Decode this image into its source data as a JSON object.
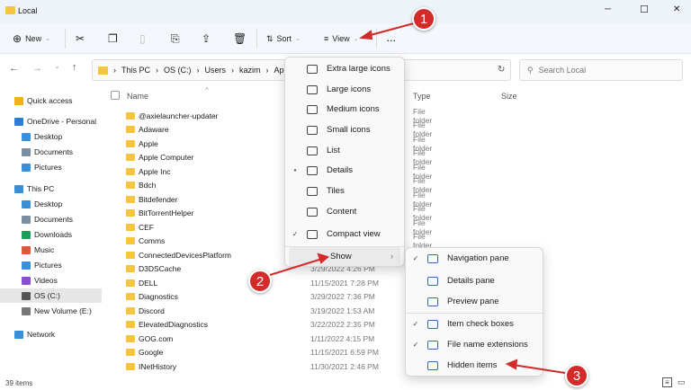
{
  "window": {
    "title": "Local",
    "minimize": "─",
    "maximize": "☐",
    "close": "✕"
  },
  "toolbar": {
    "new": "New",
    "sort": "Sort",
    "view": "View",
    "more": "..."
  },
  "address": {
    "segments": [
      "This PC",
      "OS (C:)",
      "Users",
      "kazim",
      "AppD"
    ],
    "search_placeholder": "Search Local"
  },
  "sidebar": {
    "items": [
      {
        "label": "Quick access",
        "color": "#f2b01e"
      },
      {
        "label": "OneDrive - Personal",
        "color": "#2d7dd2"
      },
      {
        "label": "Desktop",
        "color": "#3a8fd9"
      },
      {
        "label": "Documents",
        "color": "#7a8ea3"
      },
      {
        "label": "Pictures",
        "color": "#3a8fd9"
      },
      {
        "label": "This PC",
        "color": "#3a8fd9"
      },
      {
        "label": "Desktop",
        "color": "#3a8fd9"
      },
      {
        "label": "Documents",
        "color": "#7a8ea3"
      },
      {
        "label": "Downloads",
        "color": "#1e9e5a"
      },
      {
        "label": "Music",
        "color": "#e0583b"
      },
      {
        "label": "Pictures",
        "color": "#3a8fd9"
      },
      {
        "label": "Videos",
        "color": "#8a4fd0"
      },
      {
        "label": "OS (C:)",
        "color": "#555"
      },
      {
        "label": "New Volume (E:)",
        "color": "#777"
      },
      {
        "label": "Network",
        "color": "#3a8fd9"
      }
    ]
  },
  "columns": {
    "name": "Name",
    "type": "Type",
    "size": "Size"
  },
  "files": [
    {
      "name": "@axielauncher-updater",
      "date": "",
      "type": "File folder"
    },
    {
      "name": "Adaware",
      "date": "",
      "type": "File folder"
    },
    {
      "name": "Apple",
      "date": "",
      "type": "File folder"
    },
    {
      "name": "Apple Computer",
      "date": "",
      "type": "File folder"
    },
    {
      "name": "Apple Inc",
      "date": "",
      "type": "File folder"
    },
    {
      "name": "Bdch",
      "date": "",
      "type": "File folder"
    },
    {
      "name": "Bitdefender",
      "date": "",
      "type": "File folder"
    },
    {
      "name": "BitTorrentHelper",
      "date": "",
      "type": "File folder"
    },
    {
      "name": "CEF",
      "date": "",
      "type": "File folder"
    },
    {
      "name": "Comms",
      "date": "",
      "type": "File folder"
    },
    {
      "name": "ConnectedDevicesPlatform",
      "date": "",
      "type": ""
    },
    {
      "name": "D3DSCache",
      "date": "3/29/2022 4:26 PM",
      "type": ""
    },
    {
      "name": "DELL",
      "date": "11/15/2021 7:28 PM",
      "type": ""
    },
    {
      "name": "Diagnostics",
      "date": "3/29/2022 7:36 PM",
      "type": ""
    },
    {
      "name": "Discord",
      "date": "3/19/2022 1:53 AM",
      "type": ""
    },
    {
      "name": "ElevatedDiagnostics",
      "date": "3/22/2022 2:35 PM",
      "type": ""
    },
    {
      "name": "GOG.com",
      "date": "1/11/2022 4:15 PM",
      "type": ""
    },
    {
      "name": "Google",
      "date": "11/15/2021 6:59 PM",
      "type": ""
    },
    {
      "name": "INetHistory",
      "date": "11/30/2021 2:46 PM",
      "type": ""
    }
  ],
  "view_menu": [
    {
      "label": "Extra large icons",
      "mark": ""
    },
    {
      "label": "Large icons",
      "mark": ""
    },
    {
      "label": "Medium icons",
      "mark": ""
    },
    {
      "label": "Small icons",
      "mark": ""
    },
    {
      "label": "List",
      "mark": ""
    },
    {
      "label": "Details",
      "mark": "•"
    },
    {
      "label": "Tiles",
      "mark": ""
    },
    {
      "label": "Content",
      "mark": ""
    },
    {
      "label": "Compact view",
      "mark": "✓"
    }
  ],
  "show_item": {
    "label": "Show",
    "arrow": "›"
  },
  "show_menu": [
    {
      "label": "Navigation pane",
      "mark": "✓"
    },
    {
      "label": "Details pane",
      "mark": ""
    },
    {
      "label": "Preview pane",
      "mark": ""
    },
    {
      "label": "Item check boxes",
      "mark": "✓"
    },
    {
      "label": "File name extensions",
      "mark": "✓"
    },
    {
      "label": "Hidden items",
      "mark": ""
    }
  ],
  "annotations": [
    "1",
    "2",
    "3"
  ],
  "status": {
    "count": "39 items"
  },
  "colors": {
    "annotation": "#d32a2a",
    "folder": "#f5c542"
  }
}
